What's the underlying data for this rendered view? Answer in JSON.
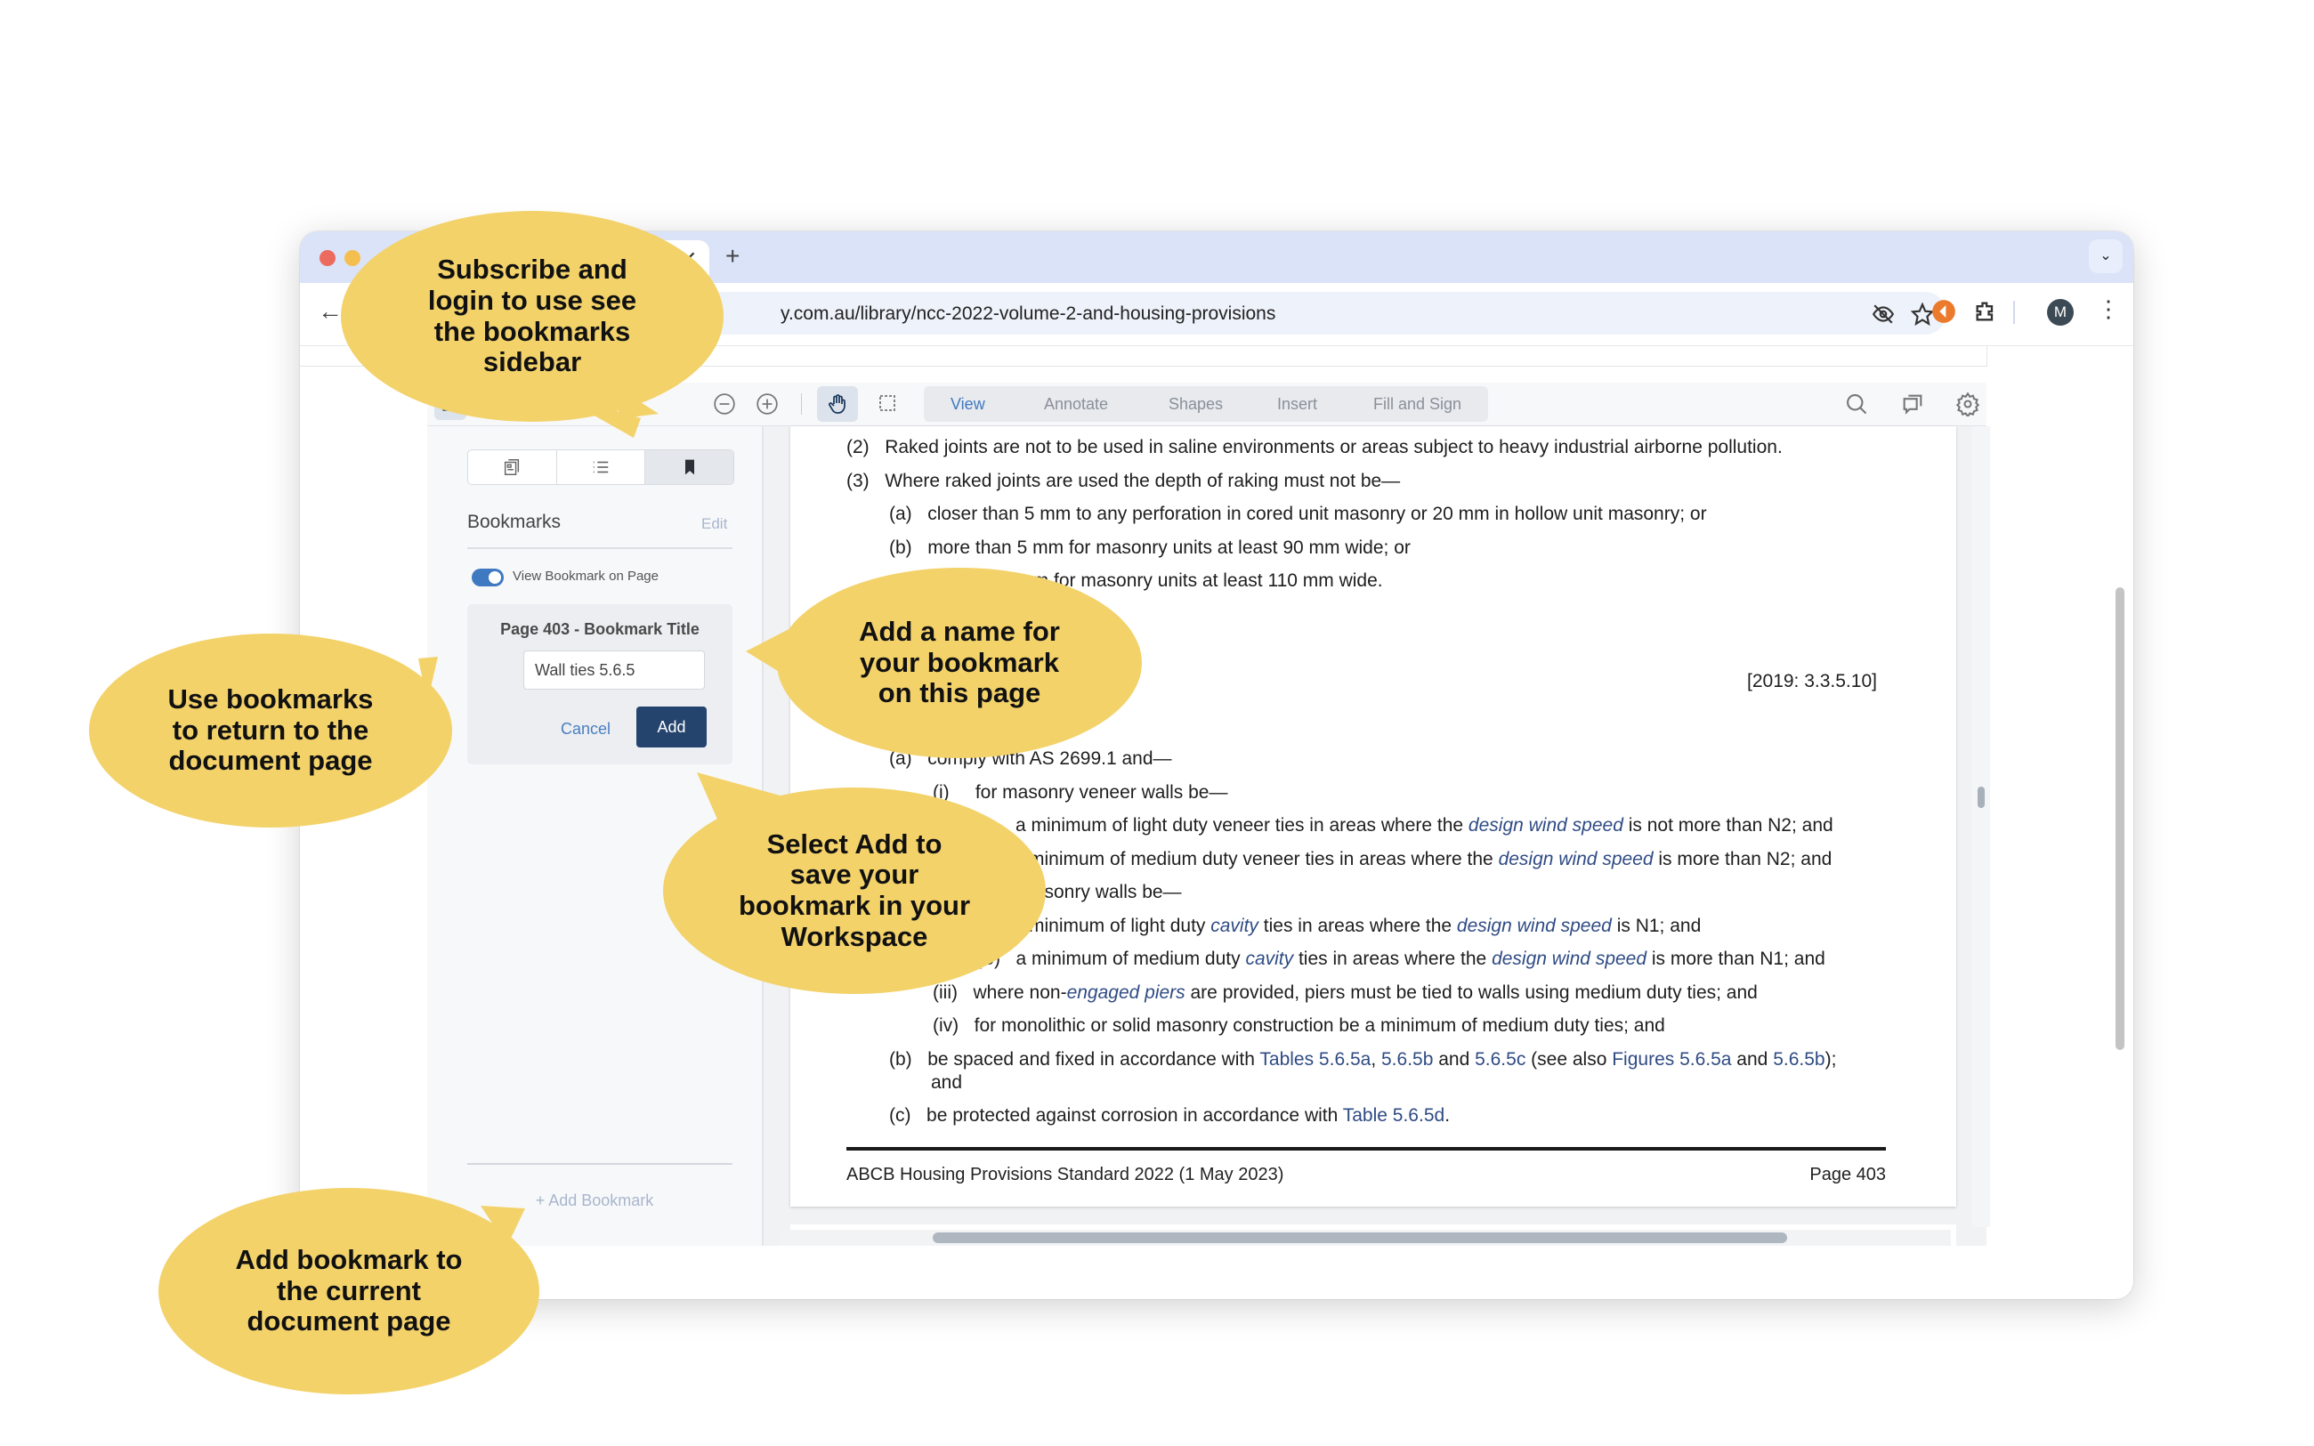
{
  "browser": {
    "tab_close": "✕",
    "new_tab": "+",
    "tab_menu": "⌄",
    "back": "←",
    "url": "y.com.au/library/ncc-2022-volume-2-and-housing-provisions",
    "profile_initial": "M",
    "colors": {
      "close": "#ed6a5e",
      "minimize": "#f5bf4f",
      "tabstrip": "#dae3f8"
    }
  },
  "toolbar": {
    "menu_tabs": [
      "View",
      "Annotate",
      "Shapes",
      "Insert",
      "Fill and Sign"
    ],
    "active_tab": "View"
  },
  "sidebar": {
    "title": "Bookmarks",
    "edit_label": "Edit",
    "toggle_label": "View Bookmark on Page",
    "toggle_on": true,
    "form": {
      "label": "Page 403 - Bookmark Title",
      "input_value": "Wall ties 5.6.5",
      "cancel_label": "Cancel",
      "add_label": "Add"
    },
    "add_bookmark_label": "+ Add Bookmark"
  },
  "document": {
    "lines": {
      "l2_num": "(2)",
      "l2": "Raked joints are not to be used in saline environments or areas subject to heavy industrial airborne pollution.",
      "l3_num": "(3)",
      "l3": "Where raked joints are used the depth of raking must not be—",
      "l3a_num": "(a)",
      "l3a": "closer than 5 mm to any perforation in cored unit masonry or 20 mm in hollow unit masonry; or",
      "l3b_num": "(b)",
      "l3b": "more than 5 mm for masonry units at least 90 mm wide; or",
      "l3c": "10 mm for masonry units at least 110 mm wide.",
      "ref": "[2019: 3.3.5.10]",
      "a_num": "(a)",
      "a": "comply with AS 2699.1 and—",
      "i_num": "(i)",
      "i": "for masonry veneer walls be—",
      "iA_pre": "a minimum of light duty veneer ties in areas where the ",
      "iA_it": "design wind speed",
      "iA_post": " is not more than N2; and",
      "iB_pre": "minimum of medium duty veneer ties in areas where the ",
      "iB_it": "design wind speed",
      "iB_post": " is more than N2; and",
      "ii_it": "y",
      "ii": " masonry walls be—",
      "iiA_pre": "minimum of light duty ",
      "iiA_it1": "cavity",
      "iiA_mid": " ties in areas where the ",
      "iiA_it2": "design wind speed",
      "iiA_post": " is N1; and",
      "iiB_num": "(B)",
      "iiB_pre": "a minimum of medium duty ",
      "iiB_it1": "cavity",
      "iiB_mid": " ties in areas where the ",
      "iiB_it2": "design wind speed",
      "iiB_post": " is more than N1; and",
      "iii_num": "(iii)",
      "iii_pre": "where non-",
      "iii_it": "engaged piers",
      "iii_post": " are provided, piers must be tied to walls using medium duty ties; and",
      "iv_num": "(iv)",
      "iv": "for monolithic or solid masonry construction be a minimum of medium duty ties; and",
      "b_num": "(b)",
      "b_pre": "be spaced and fixed in accordance with ",
      "b_l1": "Tables 5.6.5a",
      "b_c": ", ",
      "b_l2": "5.6.5b",
      "b_and": " and ",
      "b_l3": "5.6.5c",
      "b_see": " (see also ",
      "b_l4": "Figures 5.6.5a",
      "b_and2": " and ",
      "b_l5": "5.6.5b",
      "b_end": ");",
      "b_cont": "and",
      "c_num": "(c)",
      "c_pre": "be protected against corrosion in accordance with ",
      "c_l": "Table 5.6.5d",
      "c_end": "."
    },
    "footer_left": "ABCB Housing Provisions Standard 2022 (1 May 2023)",
    "footer_right": "Page 403"
  },
  "callouts": {
    "subscribe": [
      "Subscribe and",
      "login to use see",
      "the bookmarks",
      "sidebar"
    ],
    "use_bookmarks": [
      "Use bookmarks",
      "to return to the",
      "document  page"
    ],
    "add_name": [
      "Add a name for",
      "your bookmark",
      "on this page"
    ],
    "select_add": [
      "Select Add to",
      "save your",
      "bookmark in your",
      "Workspace"
    ],
    "add_current": [
      "Add bookmark to",
      "the current",
      "document page"
    ],
    "color": "#f3d26a"
  }
}
